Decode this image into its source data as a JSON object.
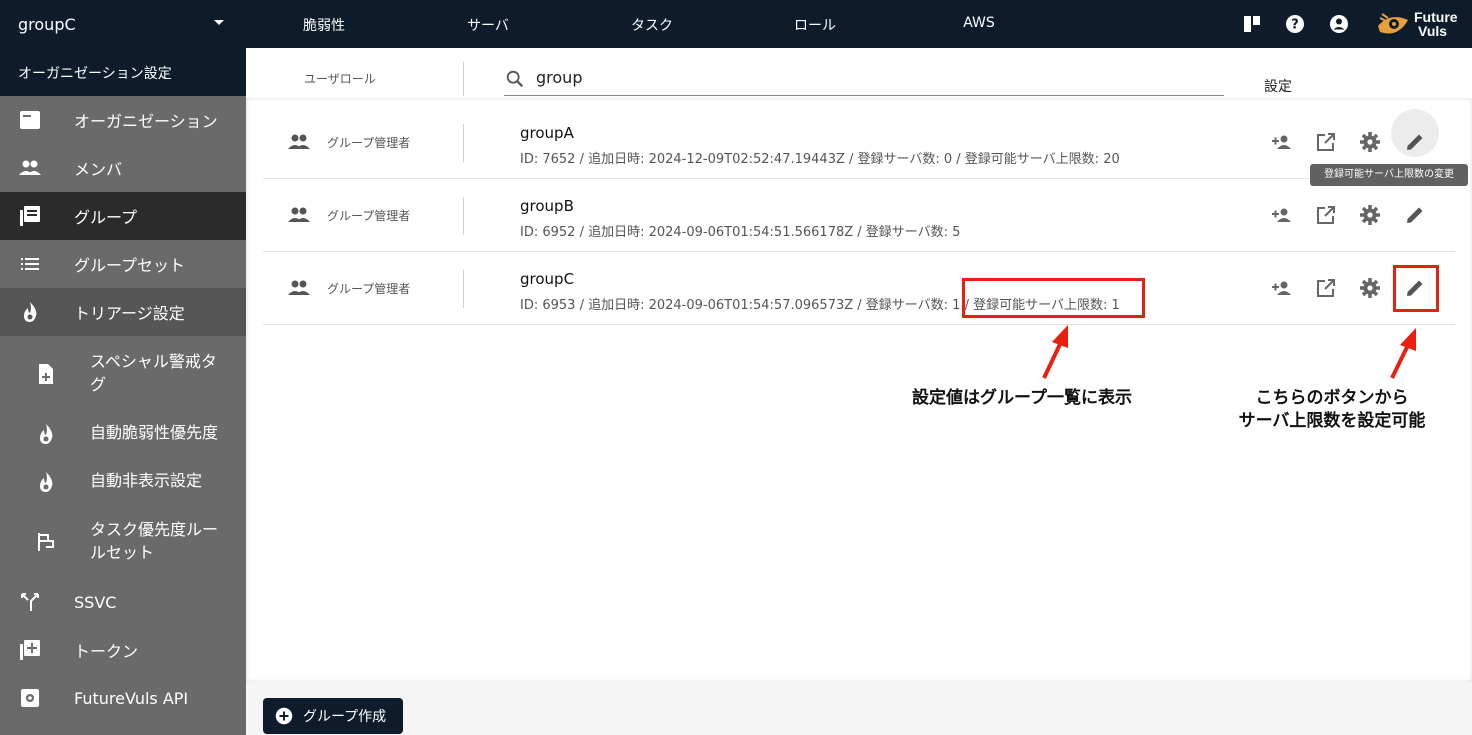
{
  "topbar": {
    "org_name": "groupC",
    "nav": [
      "脆弱性",
      "サーバ",
      "タスク",
      "ロール",
      "AWS"
    ],
    "logo_line1": "Future",
    "logo_line2": "Vuls"
  },
  "sidebar": {
    "header": "オーガニゼーション設定",
    "items": [
      {
        "label": "オーガニゼーション",
        "icon": "organization-icon"
      },
      {
        "label": "メンバ",
        "icon": "people-icon"
      },
      {
        "label": "グループ",
        "icon": "group-library-icon"
      },
      {
        "label": "グループセット",
        "icon": "list-icon"
      },
      {
        "label": "トリアージ設定",
        "icon": "flame-icon"
      },
      {
        "label": "SSVC",
        "icon": "fork-icon"
      },
      {
        "label": "トークン",
        "icon": "add-box-icon"
      },
      {
        "label": "FutureVuls API",
        "icon": "api-gear-icon"
      }
    ],
    "sub_items": [
      {
        "label": "スペシャル警戒タグ",
        "icon": "file-plus-icon"
      },
      {
        "label": "自動脆弱性優先度",
        "icon": "flame-icon"
      },
      {
        "label": "自動非表示設定",
        "icon": "flame-icon"
      },
      {
        "label": "タスク優先度ルールセット",
        "icon": "flag-tree-icon"
      }
    ]
  },
  "main": {
    "col_userrole": "ユーザロール",
    "search_value": "group",
    "col_settings": "設定",
    "rows": [
      {
        "role": "グループ管理者",
        "name": "groupA",
        "meta": "ID: 7652 / 追加日時: 2024-12-09T02:52:47.19443Z / 登録サーバ数: 0 / 登録可能サーバ上限数: 20"
      },
      {
        "role": "グループ管理者",
        "name": "groupB",
        "meta": "ID: 6952 / 追加日時: 2024-09-06T01:54:51.566178Z / 登録サーバ数: 5"
      },
      {
        "role": "グループ管理者",
        "name": "groupC",
        "meta": "ID: 6953 / 追加日時: 2024-09-06T01:54:57.096573Z / 登録サーバ数: 1 / 登録可能サーバ上限数: 1"
      }
    ],
    "tooltip": "登録可能サーバ上限数の変更",
    "create_button": "グループ作成"
  },
  "annotations": {
    "left": "設定値はグループ一覧に表示",
    "right_line1": "こちらのボタンから",
    "right_line2": "サーバ上限数を設定可能",
    "highlight_color": "#e8200e"
  },
  "colors": {
    "navy": "#0d1b2a",
    "sidebar": "#6a6a6a",
    "sidebar_active": "#2b2b2b"
  }
}
